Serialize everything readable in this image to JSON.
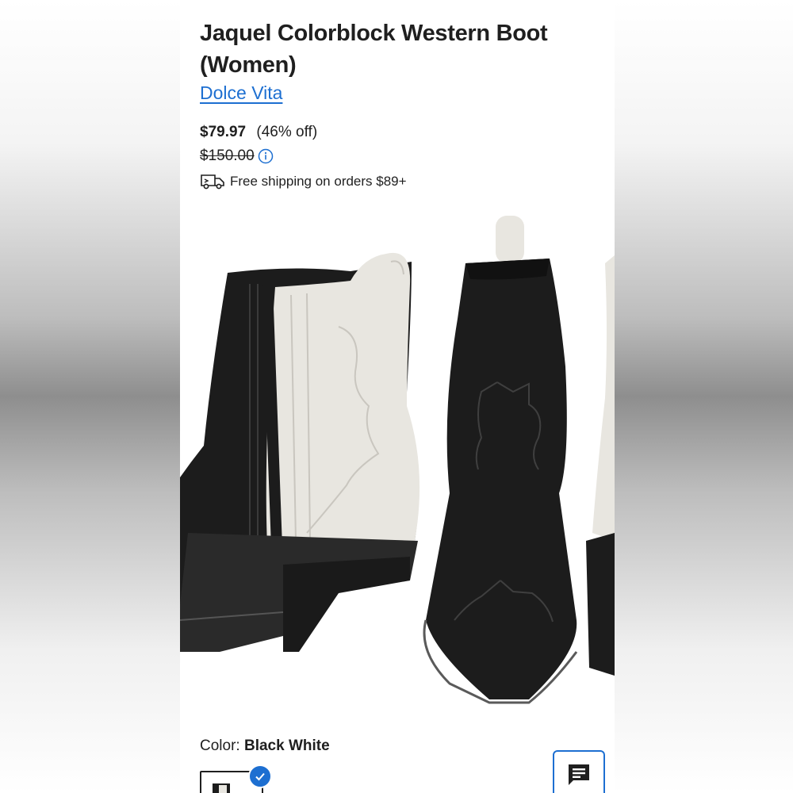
{
  "product": {
    "title": "Jaquel Colorblock Western Boot (Women)",
    "brand": "Dolce Vita"
  },
  "pricing": {
    "price": "$79.97",
    "discount": "(46% off)",
    "original_price": "$150.00"
  },
  "shipping": {
    "text": "Free shipping on orders $89+"
  },
  "color": {
    "label": "Color:",
    "value": "Black White"
  },
  "icons": {
    "info": "info-icon",
    "truck": "truck-icon",
    "check": "check-icon",
    "chat": "chat-icon"
  },
  "colors": {
    "brand_link": "#1d6fd1",
    "text": "#1f1f1f",
    "boot_black": "#1c1c1c",
    "boot_white": "#e8e6e0"
  }
}
